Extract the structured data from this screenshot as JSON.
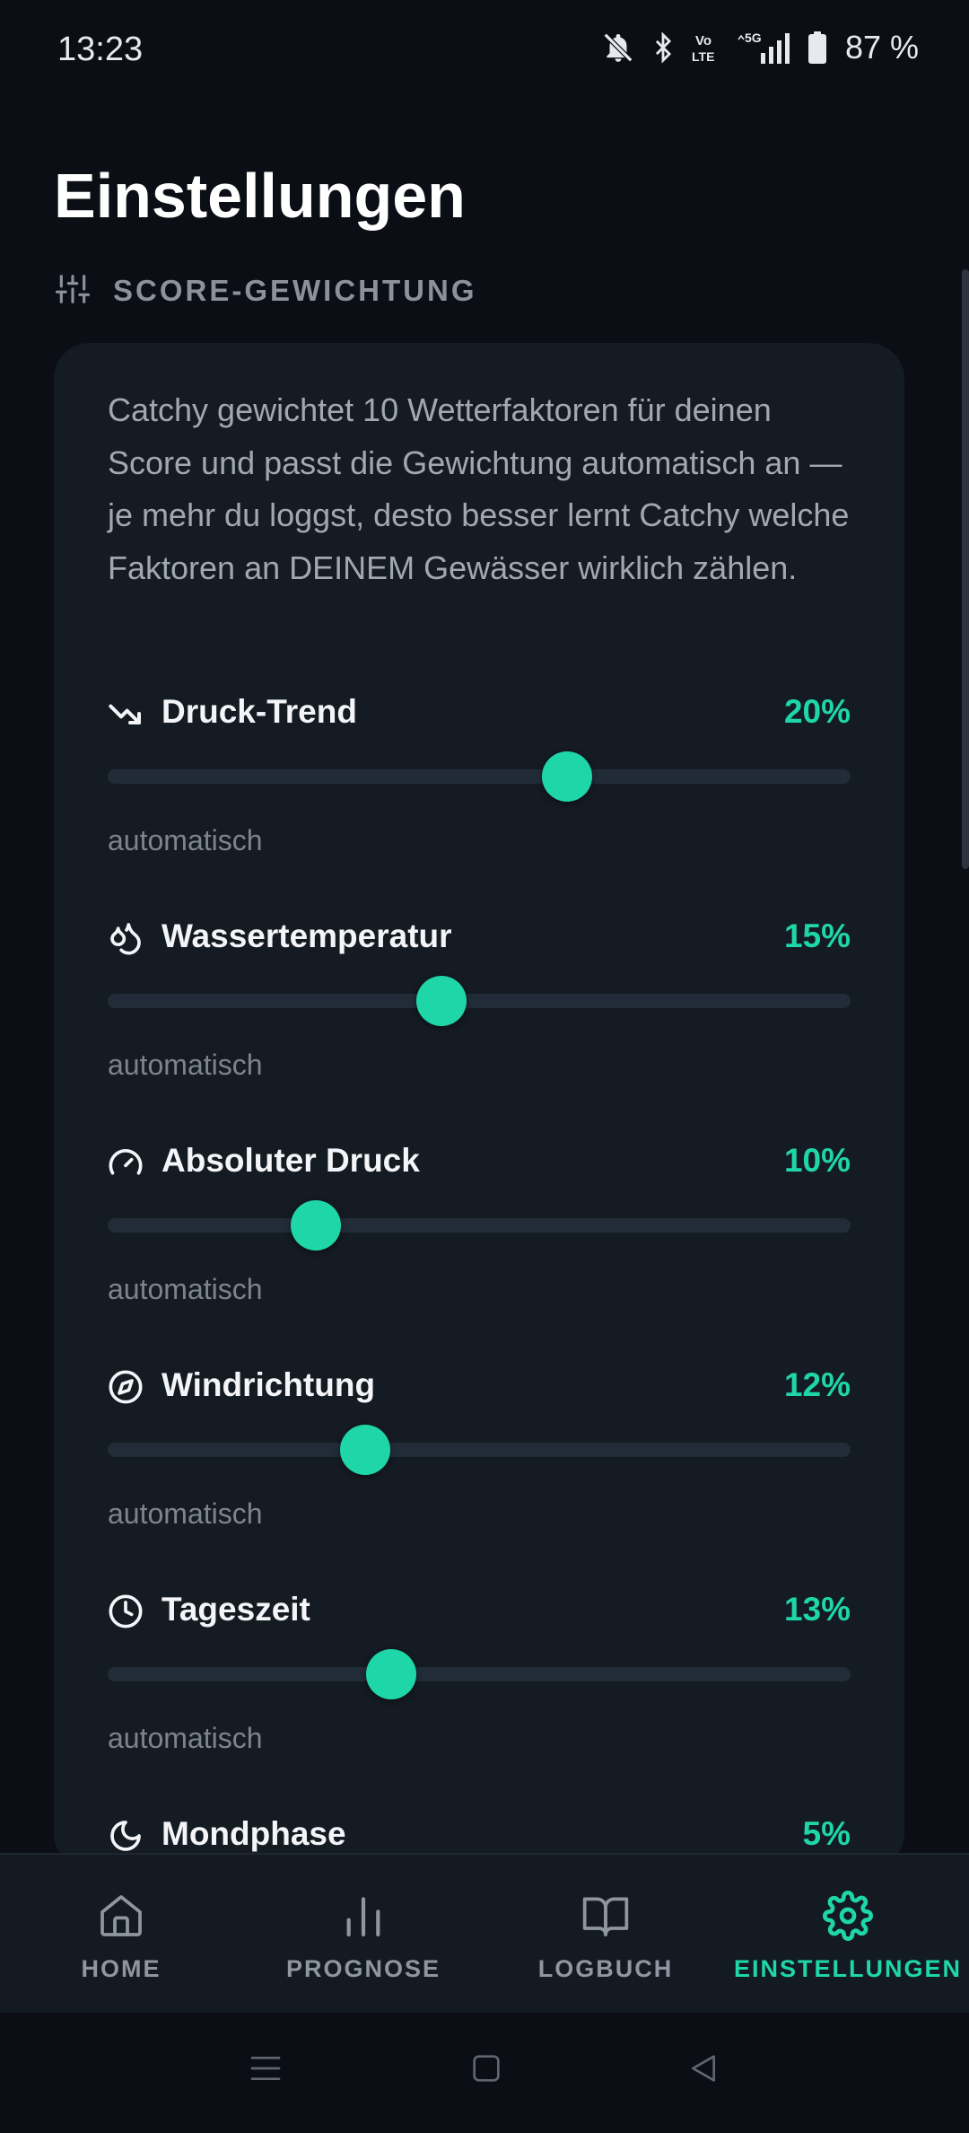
{
  "status_bar": {
    "time": "13:23",
    "network": "5G",
    "volte": "Vo LTE",
    "battery_text": "87 %",
    "icons": [
      "bell-off-icon",
      "bluetooth-icon",
      "volte-icon",
      "signal-icon",
      "battery-icon"
    ]
  },
  "page": {
    "title": "Einstellungen"
  },
  "section": {
    "icon": "sliders-icon",
    "title": "SCORE-GEWICHTUNG"
  },
  "card": {
    "description": "Catchy gewichtet 10 Wetterfaktoren für deinen Score und passt die Gewichtung automatisch an — je mehr du loggst, desto besser lernt Catchy welche Faktoren an DEINEM Gewässer wirklich zählen.",
    "factors": [
      {
        "icon": "trending-down-icon",
        "name": "Druck-Trend",
        "value": "20%",
        "mode": "automatisch",
        "slider_fraction": 0.618
      },
      {
        "icon": "droplets-icon",
        "name": "Wassertemperatur",
        "value": "15%",
        "mode": "automatisch",
        "slider_fraction": 0.449
      },
      {
        "icon": "gauge-icon",
        "name": "Absoluter Druck",
        "value": "10%",
        "mode": "automatisch",
        "slider_fraction": 0.28
      },
      {
        "icon": "compass-icon",
        "name": "Windrichtung",
        "value": "12%",
        "mode": "automatisch",
        "slider_fraction": 0.347
      },
      {
        "icon": "clock-icon",
        "name": "Tageszeit",
        "value": "13%",
        "mode": "automatisch",
        "slider_fraction": 0.382
      },
      {
        "icon": "moon-icon",
        "name": "Mondphase",
        "value": "5%"
      }
    ]
  },
  "bottom_nav": {
    "items": [
      {
        "icon": "home-icon",
        "label": "HOME",
        "active": false
      },
      {
        "icon": "bar-chart-icon",
        "label": "PROGNOSE",
        "active": false
      },
      {
        "icon": "book-icon",
        "label": "LOGBUCH",
        "active": false
      },
      {
        "icon": "gear-icon",
        "label": "EINSTELLUNGEN",
        "active": true
      }
    ]
  },
  "colors": {
    "background": "#0b0f15",
    "card": "#151b23",
    "accent": "#1ed6a8",
    "muted_text": "#a1a8b2",
    "track": "#222c38"
  }
}
